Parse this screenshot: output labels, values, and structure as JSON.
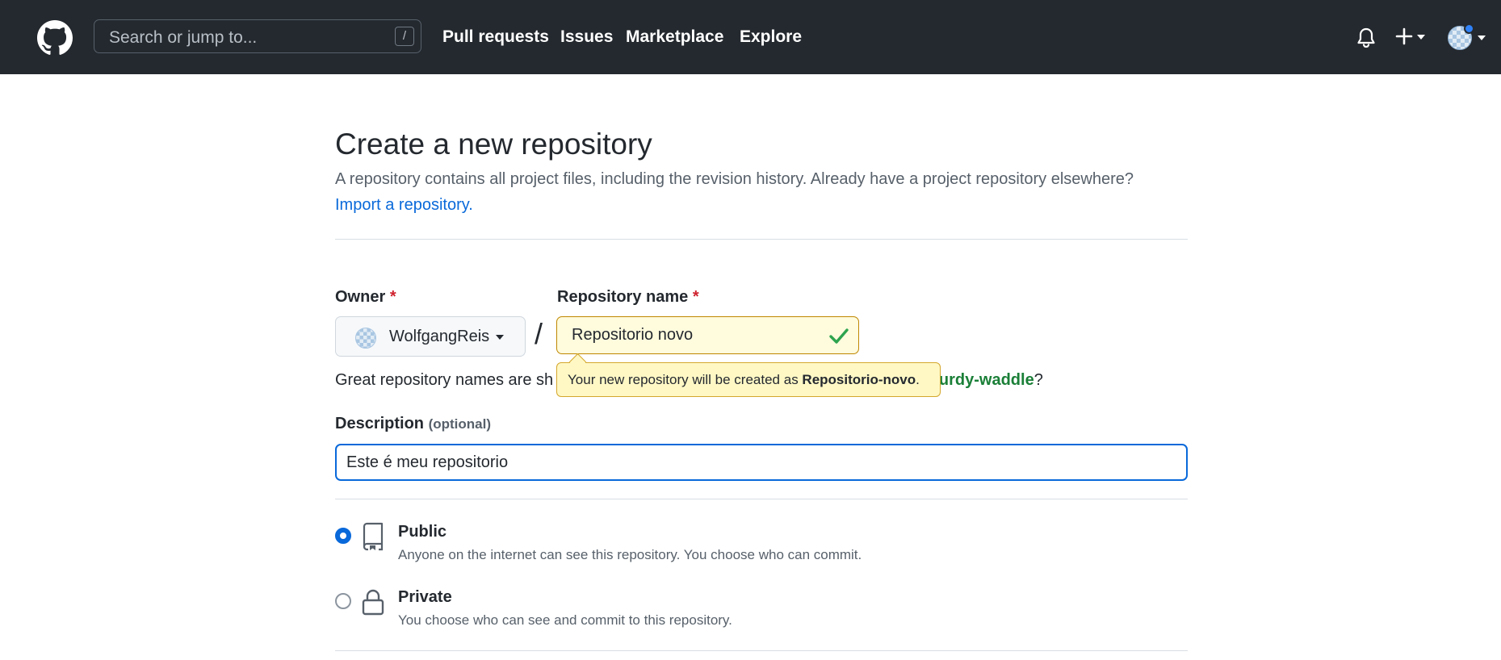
{
  "header": {
    "search_placeholder": "Search or jump to...",
    "search_shortcut": "/",
    "nav": [
      "Pull requests",
      "Issues",
      "Marketplace",
      "Explore"
    ],
    "icons": [
      "github-logo-icon",
      "bell-icon",
      "plus-icon",
      "avatar"
    ],
    "notification_dot_color": "#2f81f7",
    "bg_color": "#24292f"
  },
  "page": {
    "title": "Create a new repository",
    "subtitle": "A repository contains all project files, including the revision history. Already have a project repository elsewhere?",
    "import_link": "Import a repository."
  },
  "form": {
    "owner_label": "Owner",
    "repo_label": "Repository name",
    "required_mark": "*",
    "owner_value": "WolfgangReis",
    "separator": "/",
    "repo_value": "Repositorio novo",
    "help_prefix": "Great repository names are sh",
    "help_suggestion": "sturdy-waddle",
    "help_suffix": "?",
    "tooltip_prefix": "Your new repository will be created as ",
    "tooltip_name": "Repositorio-novo",
    "tooltip_suffix": ".",
    "description_label": "Description",
    "description_optional": "(optional)",
    "description_value": "Este é meu repositorio",
    "visibility": [
      {
        "title": "Public",
        "desc": "Anyone on the internet can see this repository. You choose who can commit.",
        "selected": true,
        "icon": "repo-icon"
      },
      {
        "title": "Private",
        "desc": "You choose who can see and commit to this repository.",
        "selected": false,
        "icon": "lock-icon"
      }
    ]
  },
  "colors": {
    "link": "#0969da",
    "valid": "#2da44e",
    "suggestion": "#1a7f37",
    "required": "#cf222e",
    "tooltip_bg": "#fff8c5"
  }
}
